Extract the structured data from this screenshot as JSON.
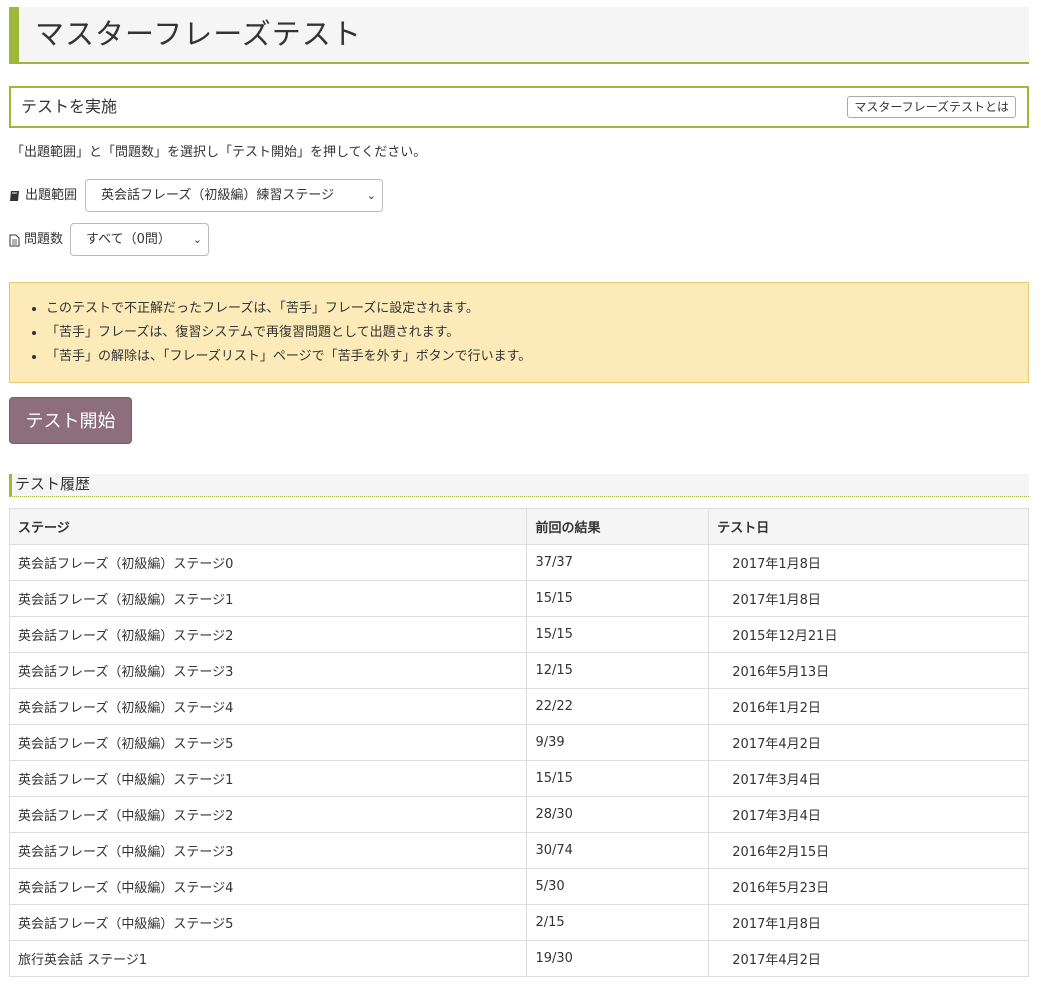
{
  "header": {
    "title": "マスターフレーズテスト"
  },
  "test_box": {
    "title": "テストを実施",
    "about_button": "マスターフレーズテストとは"
  },
  "instruction": "「出題範囲」と「問題数」を選択し「テスト開始」を押してください。",
  "range": {
    "icon": "book-icon",
    "label": "出題範囲",
    "selected": "英会話フレーズ（初級編）練習ステージ"
  },
  "count": {
    "icon": "document-icon",
    "label": "問題数",
    "selected": "すべて（0問）"
  },
  "notes": [
    "このテストで不正解だったフレーズは、「苦手」フレーズに設定されます。",
    "「苦手」フレーズは、復習システムで再復習問題として出題されます。",
    "「苦手」の解除は、「フレーズリスト」ページで「苦手を外す」ボタンで行います。"
  ],
  "start_button": "テスト開始",
  "history": {
    "title": "テスト履歴",
    "columns": [
      "ステージ",
      "前回の結果",
      "テスト日"
    ],
    "rows": [
      [
        "英会話フレーズ（初級編）ステージ0",
        "37/37",
        "2017年1月8日"
      ],
      [
        "英会話フレーズ（初級編）ステージ1",
        "15/15",
        "2017年1月8日"
      ],
      [
        "英会話フレーズ（初級編）ステージ2",
        "15/15",
        "2015年12月21日"
      ],
      [
        "英会話フレーズ（初級編）ステージ3",
        "12/15",
        "2016年5月13日"
      ],
      [
        "英会話フレーズ（初級編）ステージ4",
        "22/22",
        "2016年1月2日"
      ],
      [
        "英会話フレーズ（初級編）ステージ5",
        "9/39",
        "2017年4月2日"
      ],
      [
        "英会話フレーズ（中級編）ステージ1",
        "15/15",
        "2017年3月4日"
      ],
      [
        "英会話フレーズ（中級編）ステージ2",
        "28/30",
        "2017年3月4日"
      ],
      [
        "英会話フレーズ（中級編）ステージ3",
        "30/74",
        "2016年2月15日"
      ],
      [
        "英会話フレーズ（中級編）ステージ4",
        "5/30",
        "2016年5月23日"
      ],
      [
        "英会話フレーズ（中級編）ステージ5",
        "2/15",
        "2017年1月8日"
      ],
      [
        "旅行英会話 ステージ1",
        "19/30",
        "2017年4月2日"
      ]
    ]
  },
  "colors": {
    "accent": "#9eb93a",
    "start_button": "#8c6e7c",
    "note_bg": "#fcebb8"
  }
}
